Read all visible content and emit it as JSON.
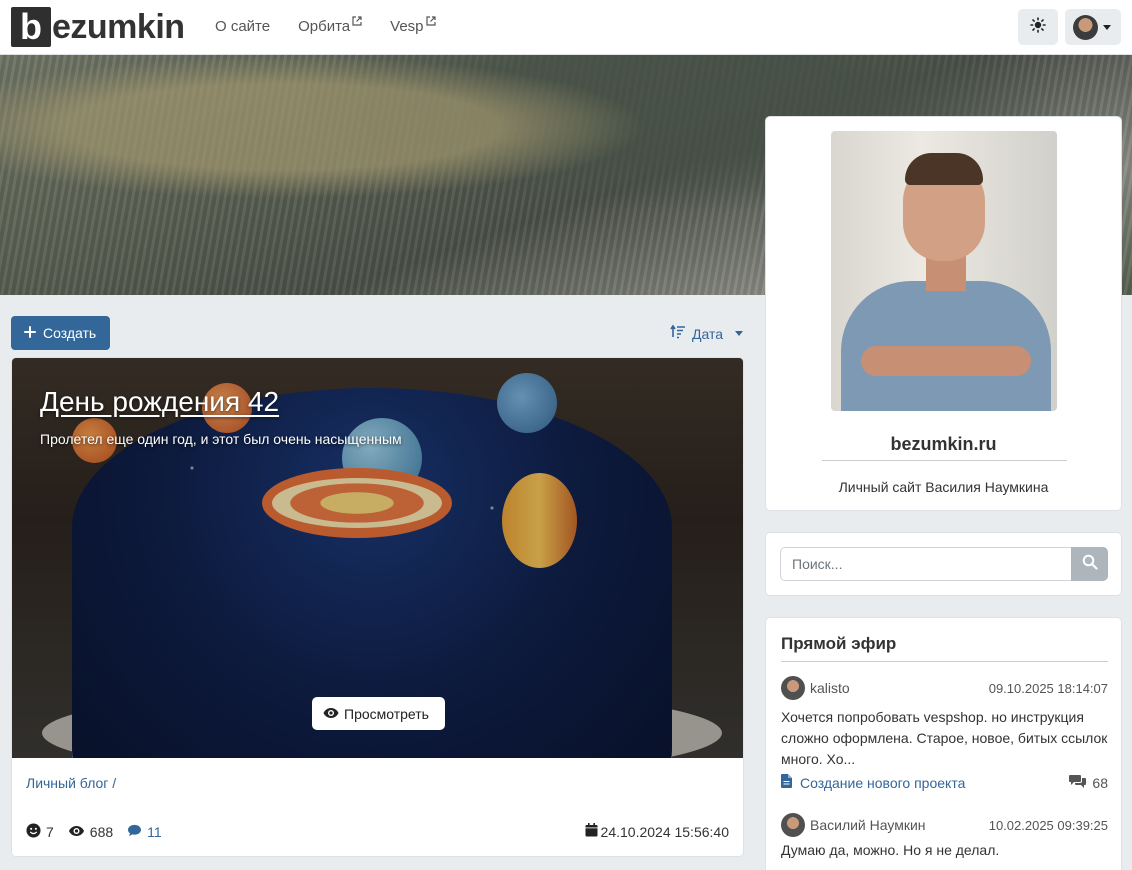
{
  "navbar": {
    "logo_letter": "b",
    "logo_rest": "ezumkin",
    "links": [
      {
        "label": "О сайте",
        "external": false
      },
      {
        "label": "Орбита",
        "external": true
      },
      {
        "label": "Vesp",
        "external": true
      }
    ]
  },
  "profile": {
    "site_name": "bezumkin.ru",
    "description": "Личный сайт Василия Наумкина"
  },
  "search": {
    "placeholder": "Поиск..."
  },
  "live": {
    "title": "Прямой эфир",
    "comments": [
      {
        "author": "kalisto",
        "date": "09.10.2025 18:14:07",
        "text": "Хочется попробовать vespshop. но инструкция сложно оформлена. Старое, новое, битых ссылок много. Хо...",
        "topic": "Создание нового проекта",
        "count": "68"
      },
      {
        "author": "Василий Наумкин",
        "date": "10.02.2025 09:39:25",
        "text": "Думаю да, можно. Но я не делал.",
        "topic": "",
        "count": ""
      }
    ]
  },
  "toolbar": {
    "create_label": "Создать",
    "sort_label": "Дата"
  },
  "post": {
    "title": "День рождения 42",
    "subtitle": "Пролетел еще один год, и этот был очень насыщенным",
    "view_label": "Просмотреть",
    "category": "Личный блог /",
    "reactions": "7",
    "views": "688",
    "comments": "11",
    "date": "24.10.2024 15:56:40"
  },
  "colors": {
    "accent": "#336699",
    "background": "#e9ecef"
  }
}
